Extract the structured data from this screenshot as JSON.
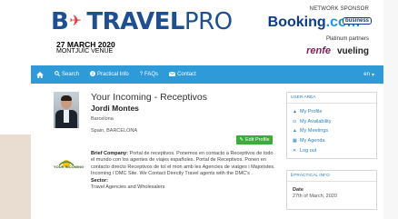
{
  "header": {
    "logo_prefix": "B",
    "logo_main": "TRAVEL",
    "logo_suffix": "PRO",
    "event_date": "27 MARCH 2020",
    "event_venue": "MONTJUÏC VENUE",
    "sponsor_label": "NETWORK SPONSOR",
    "sponsor_name_a": "Booking",
    "sponsor_name_b": ".com",
    "sponsor_badge": "business",
    "partners_label": "Platinum partners",
    "partner_1": "renfe",
    "partner_2": "vueling"
  },
  "nav": {
    "items": [
      {
        "label": "Search",
        "icon": "search-icon"
      },
      {
        "label": "Practical Info",
        "icon": "info-icon"
      },
      {
        "label": "FAQs",
        "icon": "question-icon"
      },
      {
        "label": "Contact",
        "icon": "envelope-icon"
      }
    ],
    "language": "en"
  },
  "profile": {
    "title": "Your Incoming - Receptivos",
    "name": "Jordi Montes",
    "city": "Barcelona",
    "country": "Spain, BARCELONA",
    "edit_label": "Edit Profile",
    "company_logo_text": "YOUR INCOMING",
    "brief_label": "Brief Company:",
    "brief_text": "Portal de receptivos. Ponemos en contacto a Receptivos de todo el mundo con los agentes de viajes españoles. Portal de Receptivos. Ponen en contacto directo Receptivos de tol el mon amb les Agencies de viatges i Majoristes. Incoming / DMC Site. We Contact Directly Travel agents with the DMC's .",
    "sector_label": "Sector:",
    "sector_value": "Travel Agencies and Wholesalers"
  },
  "sidebar": {
    "user_area_title": "USER AREA",
    "links": [
      {
        "label": "My Profile",
        "icon": "user-icon"
      },
      {
        "label": "My Availability",
        "icon": "clock-icon"
      },
      {
        "label": "My Meetings",
        "icon": "users-icon"
      },
      {
        "label": "My Agenda",
        "icon": "calendar-icon"
      },
      {
        "label": "Log out",
        "icon": "close-icon"
      }
    ],
    "practical_title": "PRACTICAL INFO",
    "date_label": "Date",
    "date_value": "27th of March, 2020"
  },
  "colors": {
    "navbar": "#2e9ad8",
    "brand_blue": "#1e4f95",
    "accent_red": "#e53935",
    "edit_button": "#3cab3c",
    "link_blue": "#2e7fbf"
  }
}
